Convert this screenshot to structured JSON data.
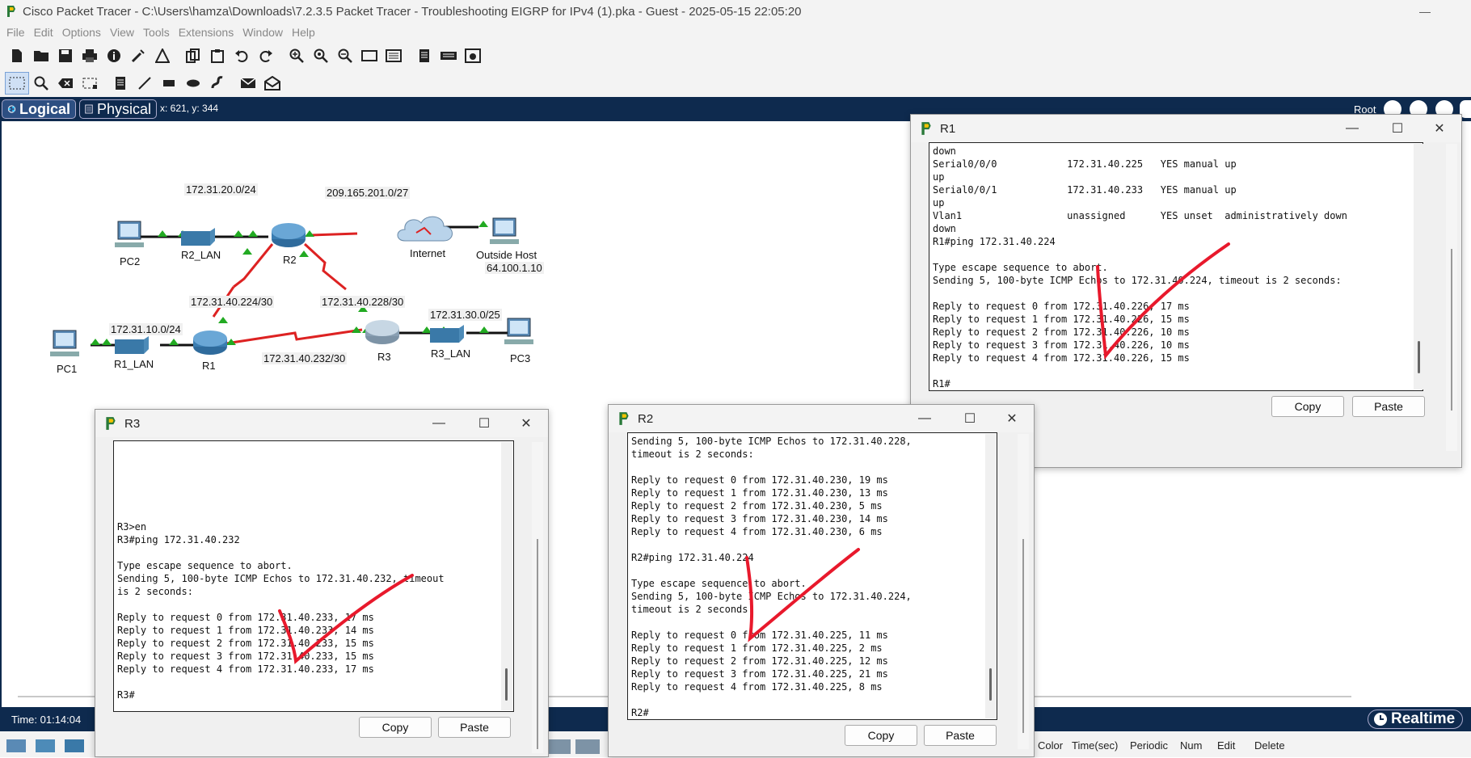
{
  "window": {
    "title": "Cisco Packet Tracer - C:\\Users\\hamza\\Downloads\\7.2.3.5 Packet Tracer - Troubleshooting EIGRP for IPv4 (1).pka - Guest - 2025-05-15 22:05:20",
    "minimize_glyph": "—"
  },
  "menu": [
    "File",
    "Edit",
    "Options",
    "View",
    "Tools",
    "Extensions",
    "Window",
    "Help"
  ],
  "nav": {
    "logical_label": "Logical",
    "physical_label": "Physical",
    "coordinates": "x: 621, y: 344",
    "root_label": "Root"
  },
  "topology": {
    "devices": [
      {
        "name": "PC2",
        "type": "pc"
      },
      {
        "name": "R2_LAN",
        "type": "switch"
      },
      {
        "name": "R2",
        "type": "router"
      },
      {
        "name": "Internet",
        "type": "cloud"
      },
      {
        "name": "Outside Host",
        "type": "pc"
      },
      {
        "name": "PC1",
        "type": "pc"
      },
      {
        "name": "R1_LAN",
        "type": "switch"
      },
      {
        "name": "R1",
        "type": "router"
      },
      {
        "name": "R3",
        "type": "router"
      },
      {
        "name": "R3_LAN",
        "type": "switch"
      },
      {
        "name": "PC3",
        "type": "pc"
      }
    ],
    "networks": {
      "r2_lan": "172.31.20.0/24",
      "isp": "209.165.201.0/27",
      "outside_ip": "64.100.1.10",
      "r1_r2": "172.31.40.224/30",
      "r2_r3": "172.31.40.228/30",
      "r3_lan": "172.31.30.0/25",
      "r1_lan": "172.31.10.0/24",
      "r1_r3": "172.31.40.232/30"
    },
    "link_colors": {
      "up": "#22aa22",
      "serial": "#dd2222",
      "ethernet": "#111111"
    }
  },
  "r1": {
    "title": "R1",
    "lines": [
      "down",
      "Serial0/0/0            172.31.40.225   YES manual up",
      "up",
      "Serial0/0/1            172.31.40.233   YES manual up",
      "up",
      "Vlan1                  unassigned      YES unset  administratively down",
      "down",
      "R1#ping 172.31.40.224",
      "",
      "Type escape sequence to abort.",
      "Sending 5, 100-byte ICMP Echos to 172.31.40.224, timeout is 2 seconds:",
      "",
      "Reply to request 0 from 172.31.40.226, 17 ms",
      "Reply to request 1 from 172.31.40.226, 15 ms",
      "Reply to request 2 from 172.31.40.226, 10 ms",
      "Reply to request 3 from 172.31.40.226, 10 ms",
      "Reply to request 4 from 172.31.40.226, 15 ms",
      "",
      "R1#"
    ],
    "copy_label": "Copy",
    "paste_label": "Paste"
  },
  "r2": {
    "title": "R2",
    "lines": [
      "Sending 5, 100-byte ICMP Echos to 172.31.40.228,",
      "timeout is 2 seconds:",
      "",
      "Reply to request 0 from 172.31.40.230, 19 ms",
      "Reply to request 1 from 172.31.40.230, 13 ms",
      "Reply to request 2 from 172.31.40.230, 5 ms",
      "Reply to request 3 from 172.31.40.230, 14 ms",
      "Reply to request 4 from 172.31.40.230, 6 ms",
      "",
      "R2#ping 172.31.40.224",
      "",
      "Type escape sequence to abort.",
      "Sending 5, 100-byte ICMP Echos to 172.31.40.224,",
      "timeout is 2 seconds:",
      "",
      "Reply to request 0 from 172.31.40.225, 11 ms",
      "Reply to request 1 from 172.31.40.225, 2 ms",
      "Reply to request 2 from 172.31.40.225, 12 ms",
      "Reply to request 3 from 172.31.40.225, 21 ms",
      "Reply to request 4 from 172.31.40.225, 8 ms",
      "",
      "R2#"
    ],
    "copy_label": "Copy",
    "paste_label": "Paste"
  },
  "r3": {
    "title": "R3",
    "lines": [
      "",
      "",
      "",
      "",
      "",
      "",
      "R3>en",
      "R3#ping 172.31.40.232",
      "",
      "Type escape sequence to abort.",
      "Sending 5, 100-byte ICMP Echos to 172.31.40.232, timeout",
      "is 2 seconds:",
      "",
      "Reply to request 0 from 172.31.40.233, 17 ms",
      "Reply to request 1 from 172.31.40.233, 14 ms",
      "Reply to request 2 from 172.31.40.233, 15 ms",
      "Reply to request 3 from 172.31.40.233, 15 ms",
      "Reply to request 4 from 172.31.40.233, 17 ms",
      "",
      "R3#"
    ],
    "copy_label": "Copy",
    "paste_label": "Paste"
  },
  "bottom": {
    "time": "Time: 01:14:04",
    "realtime_label": "Realtime",
    "columns": [
      "Color",
      "Time(sec)",
      "Periodic",
      "Num",
      "Edit",
      "Delete"
    ]
  },
  "annotation_color": "#e8192c"
}
